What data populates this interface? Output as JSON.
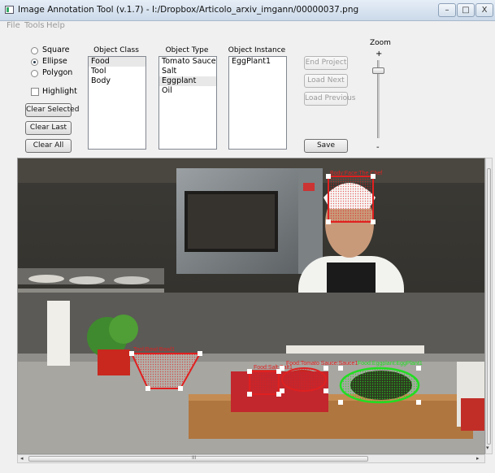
{
  "window": {
    "title": "Image Annotation Tool (v.1.7) - I:/Dropbox/Articolo_arxiv_imgann/00000037.png",
    "minimize_glyph": "–",
    "maximize_glyph": "□",
    "close_glyph": "X"
  },
  "menubar": {
    "items": [
      "File",
      "Tools",
      "Help"
    ]
  },
  "shape_options": [
    {
      "label": "Square",
      "selected": false
    },
    {
      "label": "Ellipse",
      "selected": true
    },
    {
      "label": "Polygon",
      "selected": false
    }
  ],
  "highlight": {
    "label": "Highlight",
    "checked": false
  },
  "buttons": {
    "clear_selected": "Clear Selected",
    "clear_last": "Clear Last",
    "clear_all": "Clear All",
    "end_project": "End Project",
    "load_next": "Load Next",
    "load_previous": "Load Previous",
    "save": "Save"
  },
  "lists": {
    "object_class": {
      "header": "Object Class",
      "items": [
        "Food",
        "Tool",
        "Body"
      ],
      "selected_index": 0
    },
    "object_type": {
      "header": "Object Type",
      "items": [
        "Tomato Sauce",
        "Salt",
        "Eggplant",
        "Oil"
      ],
      "selected_index": 2
    },
    "object_instance": {
      "header": "Object Instance",
      "items": [
        "EggPlant1"
      ],
      "selected_index": -1
    }
  },
  "zoom": {
    "label": "Zoom",
    "plus": "+",
    "minus": "-"
  },
  "annotations": [
    {
      "label": "Body:Face:The Chef",
      "shape": "square",
      "color": "#e02020"
    },
    {
      "label": "Tool:Bowl:Bowl1",
      "shape": "polygon",
      "color": "#e02020"
    },
    {
      "label": "Food:Salt:Salt1",
      "shape": "square",
      "color": "#e02020"
    },
    {
      "label": "Food:Tomato Sauce:Sauce1",
      "shape": "ellipse",
      "color": "#e02020"
    },
    {
      "label": "Food:Eggplant:EggPlant1",
      "shape": "ellipse",
      "color": "#22dd22"
    }
  ],
  "scrollbar": {
    "left_arrow": "◂",
    "right_arrow": "▸",
    "grip": "III",
    "down_arrow": "▾"
  }
}
